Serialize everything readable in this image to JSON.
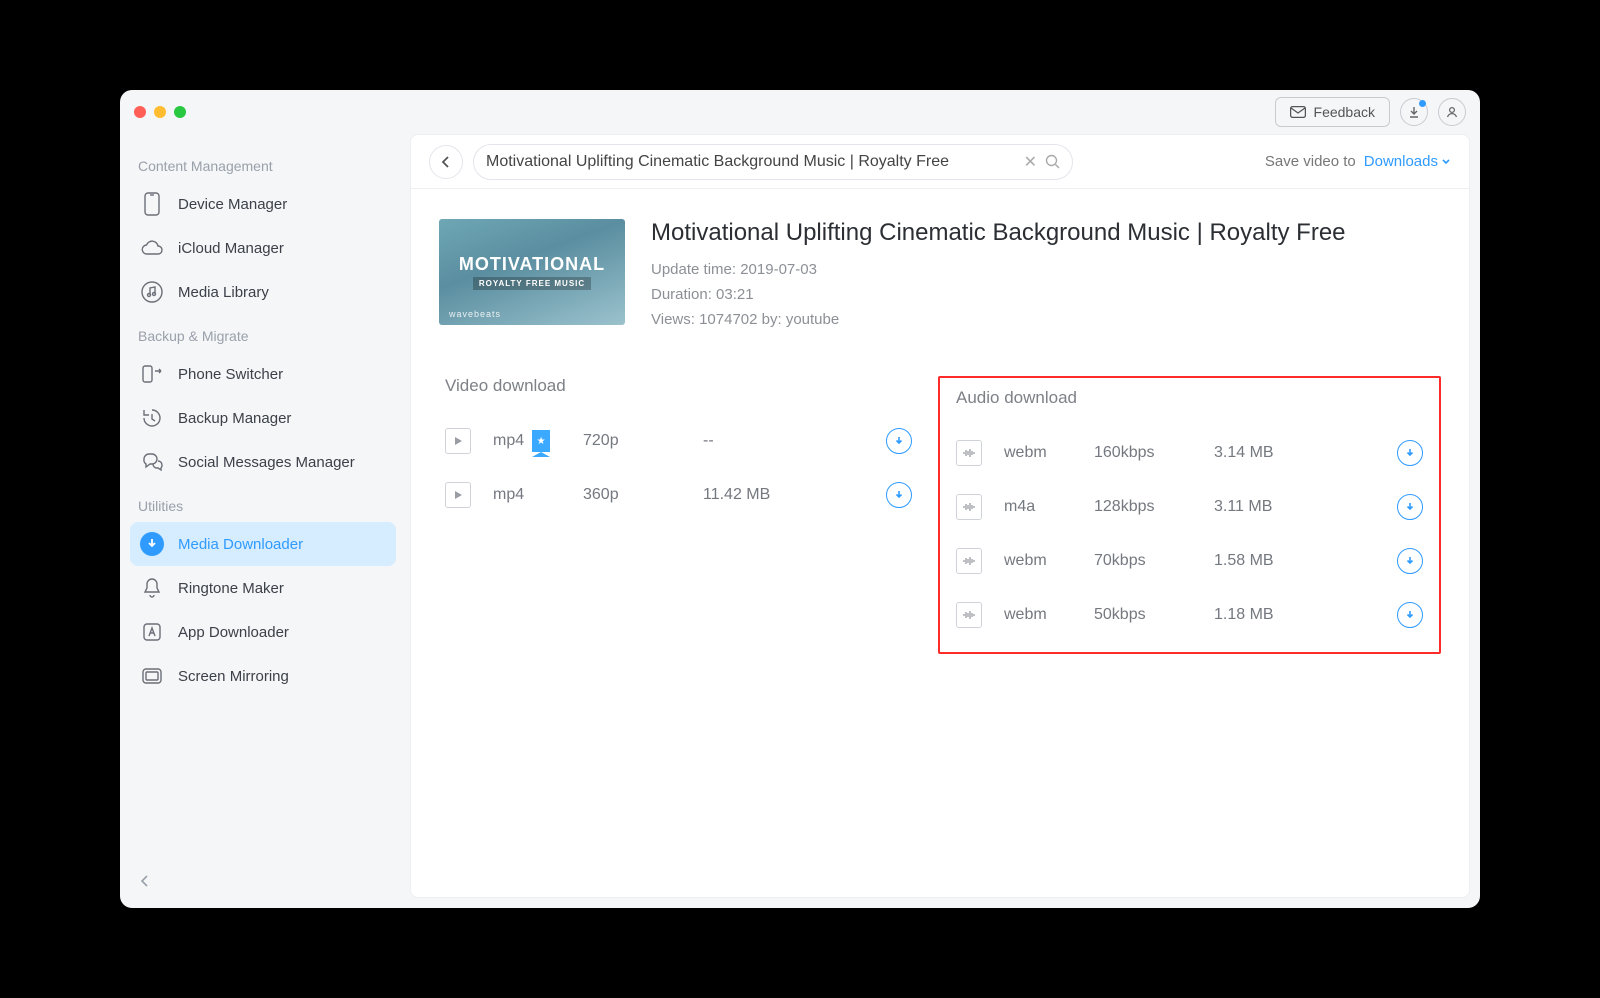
{
  "titlebar": {
    "feedback": "Feedback"
  },
  "sidebar": {
    "section1": "Content Management",
    "section2": "Backup & Migrate",
    "section3": "Utilities",
    "items": {
      "device": "Device Manager",
      "icloud": "iCloud Manager",
      "media_lib": "Media Library",
      "phone_switcher": "Phone Switcher",
      "backup_mgr": "Backup Manager",
      "social": "Social Messages Manager",
      "media_dl": "Media Downloader",
      "ringtone": "Ringtone Maker",
      "app_dl": "App Downloader",
      "screen": "Screen Mirroring"
    }
  },
  "topbar": {
    "title": "Motivational Uplifting Cinematic Background Music | Royalty Free",
    "save_label": "Save video to",
    "save_dest": "Downloads"
  },
  "media": {
    "title": "Motivational Uplifting Cinematic Background Music | Royalty Free",
    "update": "Update time: 2019-07-03",
    "duration": "Duration: 03:21",
    "views_by": "Views: 1074702    by: youtube",
    "thumb_t1": "MOTIVATIONAL",
    "thumb_t2": "ROYALTY FREE MUSIC",
    "thumb_t3": "wavebeats"
  },
  "video": {
    "heading": "Video download",
    "rows": [
      {
        "fmt": "mp4",
        "flag": true,
        "qual": "720p",
        "size": "--"
      },
      {
        "fmt": "mp4",
        "flag": false,
        "qual": "360p",
        "size": "11.42 MB"
      }
    ]
  },
  "audio": {
    "heading": "Audio download",
    "rows": [
      {
        "fmt": "webm",
        "qual": "160kbps",
        "size": "3.14 MB"
      },
      {
        "fmt": "m4a",
        "qual": "128kbps",
        "size": "3.11 MB"
      },
      {
        "fmt": "webm",
        "qual": "70kbps",
        "size": "1.58 MB"
      },
      {
        "fmt": "webm",
        "qual": "50kbps",
        "size": "1.18 MB"
      }
    ]
  }
}
